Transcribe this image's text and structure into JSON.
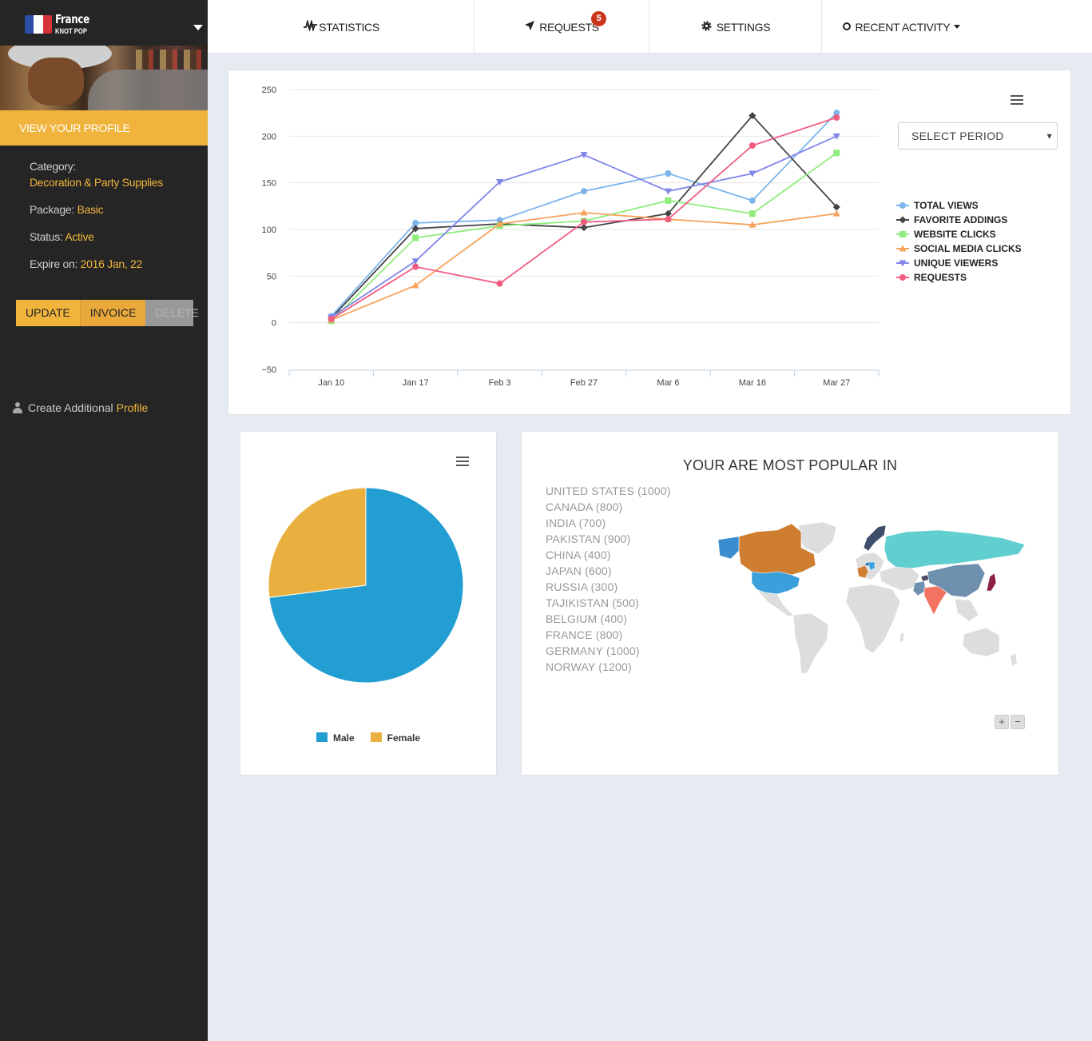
{
  "brand": {
    "title": "France",
    "subtitle": "KNOT POP",
    "flag_colors": [
      "#2b4fa8",
      "#ffffff",
      "#d6333c"
    ]
  },
  "sidebar": {
    "view_profile": "VIEW YOUR PROFILE",
    "category_label": "Category:",
    "category_value": "Decoration & Party Supplies",
    "package_label": "Package:",
    "package_value": "Basic",
    "status_label": "Status:",
    "status_value": "Active",
    "expire_label": "Expire on:",
    "expire_value": "2016 Jan, 22",
    "buttons": {
      "update": "UPDATE",
      "invoice": "INVOICE",
      "delete": "DELETE"
    },
    "create_label": "Create Additional",
    "create_value": "Profile"
  },
  "nav": {
    "statistics": "STATISTICS",
    "requests": "REQUESTS",
    "requests_badge": "5",
    "settings": "SETTINGS",
    "recent_activity": "RECENT ACTIVITY"
  },
  "line_card": {
    "select_period": "SELECT PERIOD"
  },
  "map_card": {
    "title": "YOUR ARE MOST POPULAR IN",
    "countries": [
      "UNITED STATES (1000)",
      "CANADA (800)",
      "INDIA (700)",
      "PAKISTAN (900)",
      "CHINA (400)",
      "JAPAN (600)",
      "RUSSIA (300)",
      "TAJIKISTAN (500)",
      "BELGIUM (400)",
      "FRANCE (800)",
      "GERMANY (1000)",
      "NORWAY (1200)"
    ],
    "zoom_in": "+",
    "zoom_out": "−"
  },
  "chart_data": [
    {
      "type": "line",
      "categories": [
        "Jan 10",
        "Jan 17",
        "Feb 3",
        "Feb 27",
        "Mar 6",
        "Mar 16",
        "Mar 27"
      ],
      "ylim": [
        -50,
        250
      ],
      "yticks": [
        250,
        200,
        150,
        100,
        50,
        0,
        -50
      ],
      "grid": true,
      "legend_position": "right",
      "series": [
        {
          "name": "TOTAL VIEWS",
          "color": "#7cb5ec",
          "marker": "circle",
          "values": [
            7,
            107,
            110,
            141,
            160,
            131,
            225
          ]
        },
        {
          "name": "FAVORITE ADDINGS",
          "color": "#434348",
          "marker": "diamond",
          "values": [
            5,
            101,
            106,
            102,
            117,
            222,
            124
          ]
        },
        {
          "name": "WEBSITE CLICKS",
          "color": "#90ed7d",
          "marker": "square",
          "values": [
            2,
            91,
            104,
            109,
            131,
            117,
            182
          ]
        },
        {
          "name": "SOCIAL MEDIA CLICKS",
          "color": "#f7a35c",
          "marker": "triangle",
          "values": [
            3,
            40,
            106,
            118,
            111,
            105,
            117
          ]
        },
        {
          "name": "UNIQUE VIEWERS",
          "color": "#8085e9",
          "marker": "triangle-down",
          "values": [
            6,
            66,
            151,
            180,
            141,
            160,
            200
          ]
        },
        {
          "name": "REQUESTS",
          "color": "#f15c80",
          "marker": "circle",
          "values": [
            4,
            60,
            42,
            108,
            111,
            190,
            220
          ]
        }
      ]
    },
    {
      "type": "pie",
      "legend_position": "bottom",
      "slices": [
        {
          "name": "Male",
          "value": 73,
          "color": "#229ed2"
        },
        {
          "name": "Female",
          "value": 27,
          "color": "#e9b040"
        }
      ]
    }
  ]
}
